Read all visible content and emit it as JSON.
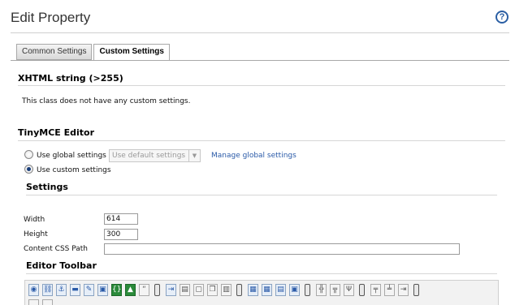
{
  "header": {
    "title": "Edit Property",
    "help_icon": "question-circle-icon",
    "help_glyph": "?"
  },
  "tabs": [
    {
      "label": "Common Settings",
      "active": false
    },
    {
      "label": "Custom Settings",
      "active": true
    }
  ],
  "xhtml_section": {
    "heading": "XHTML string (>255)",
    "message": "This class does not have any custom settings."
  },
  "tinymce_section": {
    "heading": "TinyMCE Editor",
    "global_option_label": "Use global settings",
    "global_select_value": "Use default settings",
    "manage_link": "Manage global settings",
    "custom_option_label": "Use custom settings",
    "selected_option": "custom"
  },
  "settings": {
    "heading": "Settings",
    "width_label": "Width",
    "width_value": "614",
    "height_label": "Height",
    "height_value": "300",
    "css_label": "Content CSS Path",
    "css_value": ""
  },
  "editor_toolbar": {
    "heading": "Editor Toolbar",
    "buttons": [
      "spellcheck-icon",
      "unlink-icon",
      "anchor-icon",
      "image-icon",
      "edit-image-icon",
      "insert-block-icon",
      "code-icon",
      "media-icon",
      "blockquote-icon",
      "separator-icon",
      "paste-icon",
      "paste-word-icon",
      "paste-text-icon",
      "copy-icon",
      "cut-icon",
      "separator-icon",
      "table-edit-icon",
      "table-delete-icon",
      "row-props-icon",
      "cell-props-icon",
      "separator-icon",
      "split-cell-icon",
      "merge-cell-icon",
      "delete-column-icon",
      "separator-icon",
      "insert-row-before-icon",
      "insert-row-after-icon",
      "insert-column-after-icon",
      "separator-icon"
    ],
    "accent_color": "#2a5aa8"
  }
}
